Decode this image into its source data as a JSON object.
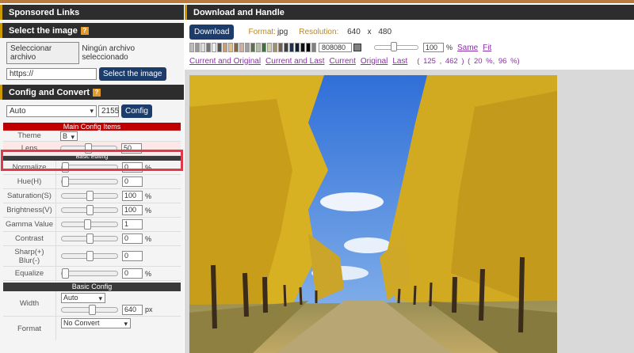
{
  "left": {
    "sponsored_title": "Sponsored Links",
    "select_title": "Select the image",
    "file_button": "Seleccionar archivo",
    "file_status": "Ningún archivo seleccionado",
    "url_value": "https://",
    "select_button": "Select the image",
    "config_title": "Config and Convert",
    "config_select": "Auto",
    "config_number": "2155",
    "config_button": "Config",
    "main_items": "Main Config Items",
    "theme_label": "Theme",
    "theme_value": "B",
    "lens_label": "Lens",
    "lens_value": "50",
    "basic_editing": "Basic Editing",
    "rows": [
      {
        "label": "Normalize",
        "value": "0",
        "unit": "%",
        "level": 0
      },
      {
        "label": "Hue(H)",
        "value": "0",
        "unit": "",
        "level": 0
      },
      {
        "label": "Saturation(S)",
        "value": "100",
        "unit": "%",
        "level": 0.5
      },
      {
        "label": "Brightness(V)",
        "value": "100",
        "unit": "%",
        "level": 0.5
      },
      {
        "label": "Gamma Value",
        "value": "1",
        "unit": "",
        "level": 0.45
      },
      {
        "label": "Contrast",
        "value": "0",
        "unit": "%",
        "level": 0.5
      },
      {
        "label": "Sharp(+) Blur(-)",
        "value": "0",
        "unit": "",
        "level": 0.5
      },
      {
        "label": "Equalize",
        "value": "0",
        "unit": "%",
        "level": 0
      }
    ],
    "basic_config": "Basic Config",
    "width_label": "Width",
    "width_select": "Auto",
    "width_value": "640",
    "width_unit": "px",
    "format_label": "Format",
    "format_select": "No Convert"
  },
  "right": {
    "title": "Download and Handle",
    "download_button": "Download",
    "format_label": "Format:",
    "format_value": "jpg",
    "resolution_label": "Resolution:",
    "res_w": "640",
    "res_x": "x",
    "res_h": "480",
    "hex_value": "808080",
    "zoom_value": "100",
    "zoom_unit": "%",
    "same_link": "Same",
    "fit_link": "Fit",
    "links": [
      "Current and Original",
      "Current and Last",
      "Current",
      "Original",
      "Last"
    ],
    "coords_text": "( 125 , 462 ) ( 20 %, 96 %)",
    "swatch_colors": [
      "#bbbbbb",
      "#999999",
      "#dddddd",
      "#777777",
      "#eeeeee",
      "#555555",
      "#c8a070",
      "#e0c090",
      "#886644",
      "#ccb0a0",
      "#a0a0a0",
      "#607050",
      "#b0c0a0",
      "#407040",
      "#d0d0b0",
      "#a09070",
      "#706050",
      "#404040",
      "#203050",
      "#102030",
      "#101010",
      "#000000",
      "#808080"
    ],
    "colors": {
      "header_bg": "#2d2d2d",
      "accent": "#cc9900",
      "button": "#1c3d6b",
      "link": "#8b2fa8",
      "highlight": "#e03a4a"
    }
  }
}
